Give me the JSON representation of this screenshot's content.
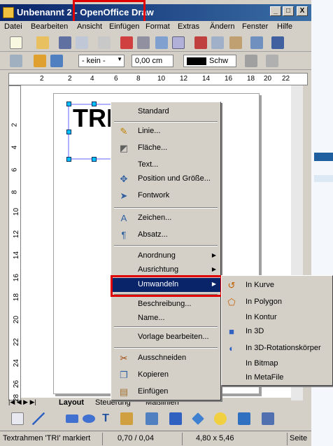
{
  "window": {
    "title_doc": "Unbenannt 2 - ",
    "title_app": "OpenOffice Draw",
    "controls": [
      "_",
      "□",
      "X"
    ]
  },
  "menubar": [
    "Datei",
    "Bearbeiten",
    "Ansicht",
    "Einfügen",
    "Format",
    "Extras",
    "Ändern",
    "Fenster",
    "Hilfe"
  ],
  "toolbar2": {
    "line_style": "- kein -",
    "line_width": "0,00 cm",
    "color": "Schw"
  },
  "ruler": {
    "h_ticks": [
      "2",
      "2",
      "4",
      "6",
      "8",
      "10",
      "12",
      "14",
      "16",
      "18",
      "20",
      "22"
    ],
    "v_ticks": [
      "2",
      "4",
      "6",
      "8",
      "10",
      "12",
      "14",
      "16",
      "18",
      "20",
      "22",
      "24",
      "26",
      "28"
    ]
  },
  "textframe": {
    "text": "TRI"
  },
  "tabs": [
    "Layout",
    "Steuerung",
    "Maßlinien"
  ],
  "context_menu": {
    "items": [
      {
        "label": "Standard",
        "icon": "none"
      },
      {
        "label": "Linie...",
        "icon": "line-icon"
      },
      {
        "label": "Fläche...",
        "icon": "area-icon"
      },
      {
        "label": "Text...",
        "icon": "none"
      },
      {
        "label": "Position und Größe...",
        "icon": "position-icon"
      },
      {
        "label": "Fontwork",
        "icon": "fontwork-icon"
      },
      {
        "label": "Zeichen...",
        "icon": "character-icon"
      },
      {
        "label": "Absatz...",
        "icon": "paragraph-icon"
      },
      {
        "label": "Anordnung",
        "icon": "none"
      },
      {
        "label": "Ausrichtung",
        "icon": "none"
      },
      {
        "label": "Umwandeln",
        "icon": "none"
      },
      {
        "label": "Beschreibung...",
        "icon": "none"
      },
      {
        "label": "Name...",
        "icon": "none"
      },
      {
        "label": "Vorlage bearbeiten...",
        "icon": "none"
      },
      {
        "label": "Ausschneiden",
        "icon": "scissors-icon"
      },
      {
        "label": "Kopieren",
        "icon": "copy-icon"
      },
      {
        "label": "Einfügen",
        "icon": "paste-icon"
      }
    ]
  },
  "submenu": {
    "items": [
      {
        "label": "In Kurve",
        "icon": "curve-icon"
      },
      {
        "label": "In Polygon",
        "icon": "polygon-icon"
      },
      {
        "label": "In Kontur",
        "icon": "none"
      },
      {
        "label": "In 3D",
        "icon": "3d-icon"
      },
      {
        "label": "In 3D-Rotationskörper",
        "icon": "3d-rotation-icon"
      },
      {
        "label": "In Bitmap",
        "icon": "none"
      },
      {
        "label": "In MetaFile",
        "icon": "none"
      }
    ]
  },
  "statusbar": {
    "message": "Textrahmen 'TRI' markiert",
    "position": "0,70 / 0,04",
    "size": "4,80 x 5,46",
    "page": "Seite"
  },
  "colors": {
    "titlebar": "#0a246a",
    "menu_bg": "#d4d0c8",
    "selection": "#0a246a",
    "highlight_box": "#e00000",
    "handle": "#00c0ff"
  }
}
